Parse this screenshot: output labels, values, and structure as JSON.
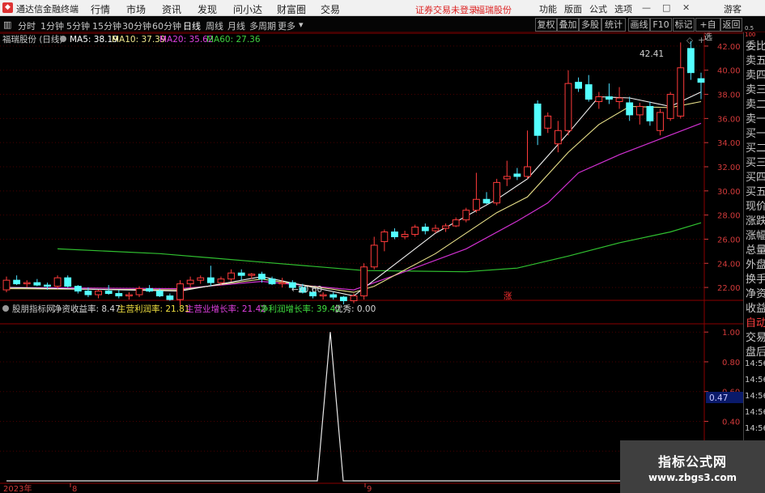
{
  "app": {
    "name": "通达信金融终端",
    "menu": [
      "行情",
      "市场",
      "资讯",
      "发现",
      "问小达",
      "财富圈",
      "交易"
    ],
    "warning": "证券交易未登录",
    "stock_name": "福瑞股份",
    "right_menu": [
      "功能",
      "版面",
      "公式",
      "选项"
    ],
    "guest": "游客"
  },
  "toolbar": {
    "periods": [
      "分时",
      "1分钟",
      "5分钟",
      "15分钟",
      "30分钟",
      "60分钟",
      "日线",
      "周线",
      "月线",
      "多周期",
      "更多"
    ],
    "active_period": "日线",
    "buttons": [
      "复权",
      "叠加",
      "多股",
      "统计",
      "画线",
      "F10",
      "标记",
      "+自选",
      "返回"
    ]
  },
  "price_chart": {
    "title": "福瑞股份 (日线)",
    "ma": [
      {
        "label": "MA5: 38.19",
        "color": "#ffffff"
      },
      {
        "label": "MA10: 37.39",
        "color": "#f0e68c"
      },
      {
        "label": "MA20: 35.62",
        "color": "#e040e0"
      },
      {
        "label": "MA60: 27.36",
        "color": "#40d040"
      }
    ],
    "annotations": {
      "high": "42.41",
      "low": "20.60",
      "limit_up_mark": "涨"
    },
    "ylabels": [
      "42.00",
      "40.00",
      "38.00",
      "36.00",
      "34.00",
      "32.00",
      "30.00",
      "28.00",
      "26.00",
      "24.00",
      "22.00"
    ]
  },
  "indicator": {
    "name": "股朋指标网",
    "values": [
      {
        "label": "净资收益率: 8.47",
        "color": "#d8d8d8"
      },
      {
        "label": "主营利润率: 21.81",
        "color": "#f0e040"
      },
      {
        "label": "主营业增长率: 21.42",
        "color": "#e040e0"
      },
      {
        "label": "净利润增长率: 39.42",
        "color": "#40e040"
      },
      {
        "label": "优秀: 0.00",
        "color": "#d8d8d8"
      }
    ],
    "ylabels": [
      "1.00",
      "0.80",
      "0.60",
      "0.40",
      "0.20"
    ],
    "current_value": "0.47"
  },
  "xaxis": {
    "year": "2023年",
    "marks": [
      "8",
      "9"
    ]
  },
  "sidepanel": {
    "items": [
      "委比",
      "卖五",
      "卖四",
      "卖三",
      "卖二",
      "卖一",
      "买一",
      "买二",
      "买三",
      "买四",
      "买五",
      "现价",
      "涨跌",
      "涨幅",
      "总量",
      "外盘",
      "换手",
      "净资",
      "收益"
    ],
    "bottom_items": [
      "自动",
      "交易",
      "盘后"
    ],
    "times": [
      "14:56",
      "14:56",
      "14:56",
      "14:56",
      "14:56",
      "14:56",
      "14:56",
      "14:56"
    ],
    "top_icons": [
      "0.5",
      "100"
    ]
  },
  "watermark": {
    "title": "指标公式网",
    "url": "www.zbgs3.com"
  },
  "chart_data": {
    "type": "candlestick",
    "candles": [
      [
        21.8,
        22.9,
        21.6,
        22.6
      ],
      [
        22.6,
        23.0,
        22.2,
        22.3
      ],
      [
        22.3,
        22.6,
        22.0,
        22.4
      ],
      [
        22.4,
        22.7,
        22.1,
        22.2
      ],
      [
        22.2,
        22.4,
        21.8,
        22.1
      ],
      [
        22.1,
        23.0,
        21.9,
        22.8
      ],
      [
        22.8,
        23.0,
        22.0,
        22.1
      ],
      [
        22.1,
        22.2,
        21.5,
        21.7
      ],
      [
        21.7,
        22.0,
        21.2,
        21.4
      ],
      [
        21.4,
        21.8,
        21.1,
        21.7
      ],
      [
        21.7,
        22.2,
        21.4,
        21.5
      ],
      [
        21.5,
        21.8,
        21.1,
        21.3
      ],
      [
        21.3,
        21.6,
        21.0,
        21.4
      ],
      [
        21.4,
        22.1,
        21.2,
        21.9
      ],
      [
        21.9,
        22.2,
        21.6,
        21.7
      ],
      [
        21.7,
        21.9,
        21.2,
        21.3
      ],
      [
        21.3,
        21.5,
        20.9,
        21.0
      ],
      [
        21.0,
        22.6,
        20.5,
        22.3
      ],
      [
        22.3,
        22.9,
        22.0,
        22.6
      ],
      [
        22.6,
        23.0,
        22.3,
        22.8
      ],
      [
        22.8,
        23.8,
        22.1,
        22.4
      ],
      [
        22.4,
        22.9,
        22.2,
        22.7
      ],
      [
        22.7,
        23.5,
        22.5,
        23.2
      ],
      [
        23.2,
        23.5,
        22.6,
        23.0
      ],
      [
        23.0,
        23.2,
        22.7,
        23.1
      ],
      [
        23.1,
        23.3,
        22.4,
        22.7
      ],
      [
        22.7,
        22.9,
        22.2,
        22.3
      ],
      [
        22.3,
        22.8,
        22.0,
        22.4
      ],
      [
        22.4,
        22.6,
        21.9,
        22.0
      ],
      [
        22.0,
        22.3,
        21.5,
        21.6
      ],
      [
        21.6,
        21.8,
        21.1,
        21.3
      ],
      [
        21.3,
        21.6,
        21.0,
        21.4
      ],
      [
        21.4,
        21.6,
        21.0,
        21.2
      ],
      [
        21.2,
        21.3,
        20.6,
        20.9
      ],
      [
        20.9,
        21.5,
        20.7,
        21.3
      ],
      [
        21.3,
        24.0,
        21.0,
        23.7
      ],
      [
        23.7,
        26.2,
        23.5,
        25.5
      ],
      [
        25.8,
        26.8,
        25.0,
        26.6
      ],
      [
        26.6,
        26.9,
        26.0,
        26.2
      ],
      [
        26.2,
        26.7,
        26.0,
        26.4
      ],
      [
        26.4,
        27.2,
        26.2,
        27.0
      ],
      [
        27.0,
        27.3,
        26.4,
        26.7
      ],
      [
        26.7,
        27.2,
        26.5,
        26.9
      ],
      [
        26.9,
        27.3,
        26.6,
        27.1
      ],
      [
        27.1,
        27.8,
        27.0,
        27.6
      ],
      [
        27.6,
        28.6,
        27.4,
        28.4
      ],
      [
        28.4,
        31.5,
        28.2,
        29.3
      ],
      [
        29.3,
        29.9,
        28.9,
        29.0
      ],
      [
        29.0,
        31.0,
        28.8,
        30.7
      ],
      [
        31.0,
        32.5,
        30.4,
        31.2
      ],
      [
        31.4,
        31.9,
        30.9,
        31.2
      ],
      [
        31.2,
        35.0,
        31.0,
        32.0
      ],
      [
        37.2,
        37.5,
        33.8,
        34.6
      ],
      [
        35.2,
        36.5,
        34.8,
        36.2
      ],
      [
        33.9,
        35.8,
        33.2,
        35.0
      ],
      [
        35.0,
        40.0,
        34.6,
        38.9
      ],
      [
        39.0,
        39.4,
        38.2,
        38.5
      ],
      [
        38.8,
        39.6,
        37.4,
        37.6
      ],
      [
        37.4,
        38.2,
        36.8,
        37.8
      ],
      [
        37.8,
        38.9,
        37.2,
        37.6
      ],
      [
        37.4,
        38.6,
        36.8,
        37.7
      ],
      [
        37.3,
        37.8,
        35.8,
        36.3
      ],
      [
        36.3,
        37.3,
        35.5,
        37.0
      ],
      [
        37.0,
        37.4,
        35.4,
        35.8
      ],
      [
        35.0,
        36.8,
        34.6,
        36.5
      ],
      [
        36.0,
        38.2,
        35.8,
        38.0
      ],
      [
        36.2,
        42.3,
        36.0,
        40.2
      ],
      [
        41.8,
        42.4,
        39.2,
        39.8
      ],
      [
        39.3,
        39.8,
        37.6,
        39.0
      ]
    ],
    "ma5": [
      [
        0,
        22.0
      ],
      [
        17,
        21.7
      ],
      [
        25,
        22.9
      ],
      [
        34,
        21.3
      ],
      [
        36,
        22.6
      ],
      [
        42,
        26.5
      ],
      [
        48,
        29.3
      ],
      [
        51,
        31.0
      ],
      [
        55,
        34.8
      ],
      [
        58,
        37.8
      ],
      [
        61,
        37.7
      ],
      [
        65,
        37.0
      ],
      [
        68,
        38.2
      ]
    ],
    "ma10": [
      [
        0,
        21.9
      ],
      [
        17,
        21.8
      ],
      [
        25,
        22.7
      ],
      [
        34,
        21.6
      ],
      [
        36,
        22.1
      ],
      [
        42,
        24.8
      ],
      [
        48,
        28.2
      ],
      [
        51,
        29.5
      ],
      [
        55,
        33.2
      ],
      [
        58,
        35.5
      ],
      [
        61,
        37.0
      ],
      [
        65,
        36.9
      ],
      [
        68,
        37.4
      ]
    ],
    "ma20": [
      [
        0,
        22.0
      ],
      [
        17,
        21.9
      ],
      [
        25,
        22.5
      ],
      [
        34,
        21.8
      ],
      [
        38,
        23.0
      ],
      [
        45,
        25.2
      ],
      [
        50,
        27.5
      ],
      [
        53,
        29.0
      ],
      [
        56,
        31.5
      ],
      [
        60,
        33.0
      ],
      [
        64,
        34.3
      ],
      [
        68,
        35.6
      ]
    ],
    "ma60": [
      [
        5,
        25.2
      ],
      [
        15,
        24.8
      ],
      [
        25,
        24.1
      ],
      [
        35,
        23.4
      ],
      [
        45,
        23.3
      ],
      [
        50,
        23.6
      ],
      [
        55,
        24.6
      ],
      [
        60,
        25.7
      ],
      [
        65,
        26.6
      ],
      [
        68,
        27.36
      ]
    ],
    "price_ylim": [
      21.0,
      43.0
    ],
    "indicator_series": [
      [
        0,
        0
      ],
      [
        24,
        0
      ],
      [
        25,
        1
      ],
      [
        26,
        0
      ],
      [
        68,
        0
      ]
    ],
    "indicator_ylim": [
      0,
      1.05
    ]
  }
}
